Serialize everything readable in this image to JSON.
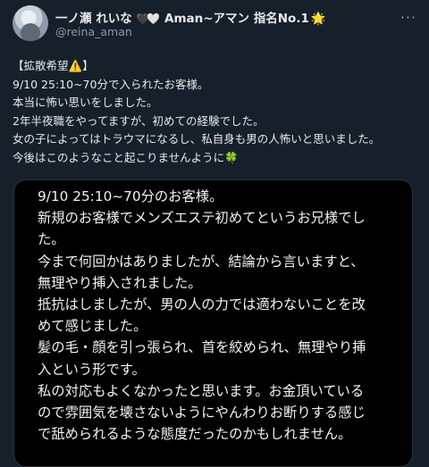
{
  "user": {
    "display_name": "一ノ瀬 れいな",
    "hearts": "🖤🤍",
    "name_suffix": "Aman~アマン 指名No.1",
    "star": "🌟",
    "handle": "@reina_aman",
    "avatar_icon": "profile-photo",
    "more_icon": "more-icon"
  },
  "tweet": {
    "heading_text": "【拡散希望",
    "warning_emoji": "⚠️",
    "heading_close": "】",
    "lines": [
      "9/10 25:10~70分で入られたお客様。",
      "本当に怖い思いをしました。",
      "2年半夜職をやってますが、初めての経験でした。",
      "女の子によってはトラウマになるし、私自身も男の人怖いと思いました。"
    ],
    "last_line": "今後はこのようなこと起こりませんように",
    "clover_emoji": "🍀"
  },
  "media": {
    "lines": [
      "9/10 25:10~70分のお客様。",
      "新規のお客様でメンズエステ初めてというお兄様でし",
      "た。",
      "今まで何回かはありましたが、結論から言いますと、",
      "無理やり挿入されました。",
      "抵抗はしましたが、男の人の力では適わないことを改",
      "めて感じました。",
      "髪の毛・顔を引っ張られ、首を絞められ、無理やり挿",
      "入という形です。",
      "私の対応もよくなかったと思います。お金頂いている",
      "ので雰囲気を壊さないようにやんわりお断りする感じ",
      "で舐められるような態度だったのかもしれません。"
    ]
  },
  "colors": {
    "background": "#15202b",
    "text": "#e7e9ea",
    "secondary": "#8b98a5",
    "media_background": "#000000"
  }
}
